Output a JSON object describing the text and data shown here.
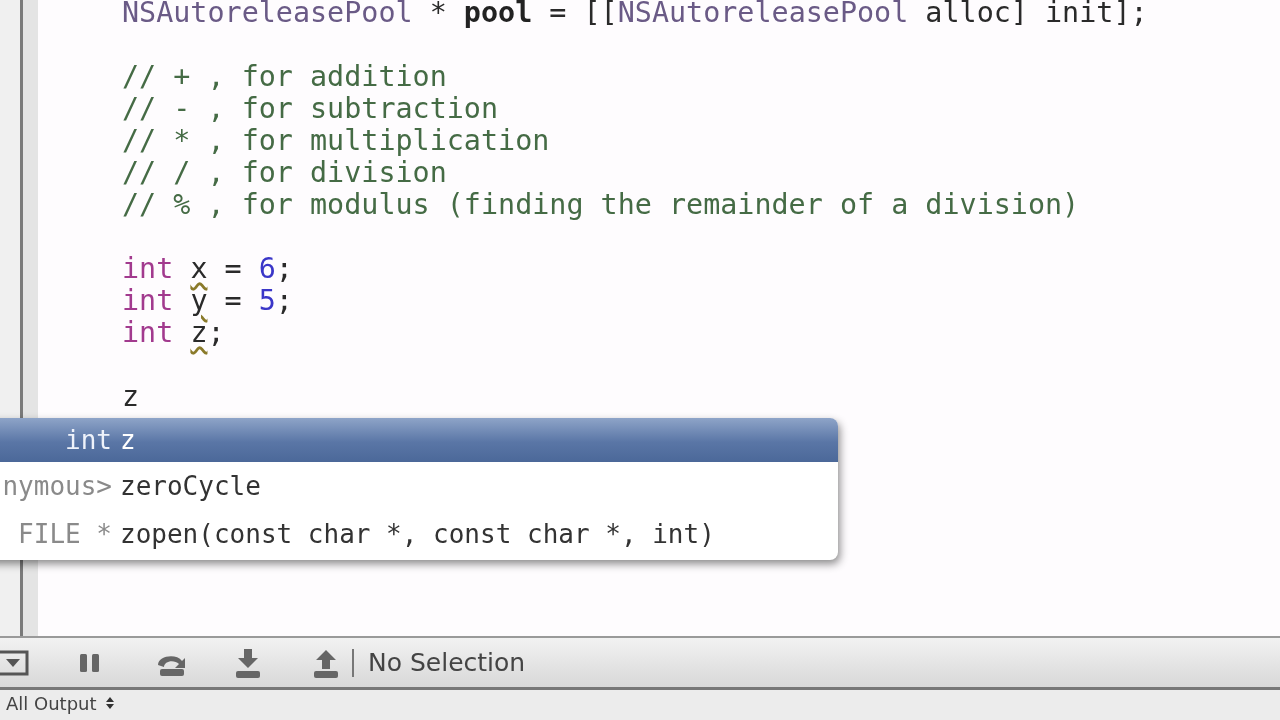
{
  "editor": {
    "lines": [
      {
        "tokens": [
          {
            "kind": "type",
            "text": "NSAutoreleasePool"
          },
          {
            "kind": "plain",
            "text": " * "
          },
          {
            "kind": "bold",
            "text": "pool"
          },
          {
            "kind": "plain",
            "text": " = [["
          },
          {
            "kind": "type",
            "text": "NSAutoreleasePool"
          },
          {
            "kind": "plain",
            "text": " alloc] init];"
          }
        ]
      },
      {
        "space_before": true,
        "tokens": [
          {
            "kind": "comment",
            "text": "// + , for addition"
          }
        ]
      },
      {
        "tokens": [
          {
            "kind": "comment",
            "text": "// - , for subtraction"
          }
        ]
      },
      {
        "tokens": [
          {
            "kind": "comment",
            "text": "// * , for multiplication"
          }
        ]
      },
      {
        "tokens": [
          {
            "kind": "comment",
            "text": "// / , for division"
          }
        ]
      },
      {
        "tokens": [
          {
            "kind": "comment",
            "text": "// % , for modulus (finding the remainder of a division)"
          }
        ]
      },
      {
        "space_before": true,
        "tokens": [
          {
            "kind": "keyword",
            "text": "int "
          },
          {
            "kind": "plain",
            "text": "x",
            "warning": true
          },
          {
            "kind": "plain",
            "text": " = "
          },
          {
            "kind": "number",
            "text": "6"
          },
          {
            "kind": "plain",
            "text": ";"
          }
        ]
      },
      {
        "tokens": [
          {
            "kind": "keyword",
            "text": "int "
          },
          {
            "kind": "plain",
            "text": "y",
            "warning": true
          },
          {
            "kind": "plain",
            "text": " = "
          },
          {
            "kind": "number",
            "text": "5"
          },
          {
            "kind": "plain",
            "text": ";"
          }
        ]
      },
      {
        "tokens": [
          {
            "kind": "keyword",
            "text": "int "
          },
          {
            "kind": "plain",
            "text": "z",
            "warning": true
          },
          {
            "kind": "plain",
            "text": ";"
          }
        ]
      },
      {
        "space_before": true,
        "tokens": [
          {
            "kind": "plain",
            "text": "z"
          }
        ]
      }
    ]
  },
  "completion": {
    "items": [
      {
        "type": "int",
        "name": "z",
        "selected": true
      },
      {
        "type": "nymous>",
        "name": "zeroCycle",
        "selected": false
      },
      {
        "type": "FILE *",
        "name": "zopen(const char *, const char *, int)",
        "selected": false
      }
    ]
  },
  "debug_bar": {
    "buttons": [
      {
        "kind": "dropdown"
      },
      {
        "kind": "pause"
      },
      {
        "kind": "step-over"
      },
      {
        "kind": "step-into"
      },
      {
        "kind": "step-out"
      }
    ],
    "status": "No Selection"
  },
  "console": {
    "scope": "All Output"
  }
}
